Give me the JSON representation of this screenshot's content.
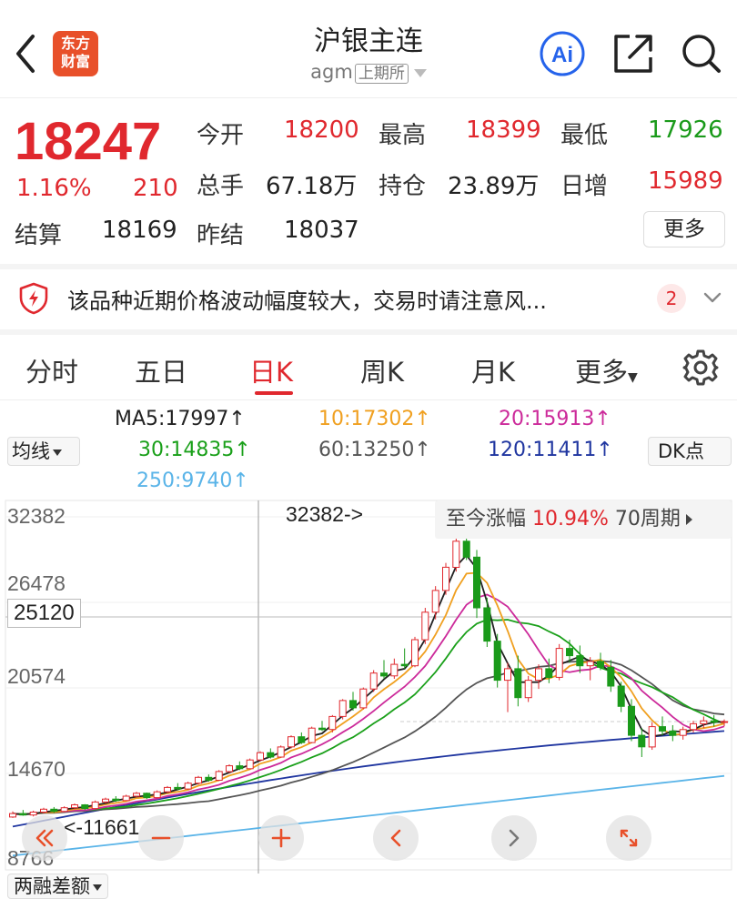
{
  "header": {
    "title": "沪银主连",
    "code": "agm",
    "exchange": "上期所",
    "logo_line1": "东方",
    "logo_line2": "财富",
    "ai_label": "Ai"
  },
  "quote": {
    "price": "18247",
    "change_pct": "1.16%",
    "change": "210",
    "fields": {
      "open_label": "今开",
      "open": "18200",
      "high_label": "最高",
      "high": "18399",
      "low_label": "最低",
      "low": "17926",
      "volume_label": "总手",
      "volume": "67.18万",
      "oi_label": "持仓",
      "oi": "23.89万",
      "daily_inc_label": "日增",
      "daily_inc": "15989",
      "settle_label": "结算",
      "settle": "18169",
      "prev_settle_label": "昨结",
      "prev_settle": "18037"
    },
    "more_label": "更多"
  },
  "notice": {
    "text": "该品种近期价格波动幅度较大，交易时请注意风...",
    "badge": "2"
  },
  "tabs": {
    "items": [
      "分时",
      "五日",
      "日K",
      "周K",
      "月K",
      "更多"
    ],
    "active_index": 2
  },
  "indicators": {
    "ma5": "MA5:17997↑",
    "ma10": "10:17302↑",
    "ma20": "20:15913↑",
    "ma30": "30:14835↑",
    "ma60": "60:13250↑",
    "ma120": "120:11411↑",
    "ma250": "250:9740↑",
    "selector": "均线",
    "dk": "DK点"
  },
  "chart": {
    "y_ticks": [
      "32382",
      "26478",
      "20574",
      "14670",
      "8766"
    ],
    "current_price_tag": "25120",
    "high_marker": "32382->",
    "low_marker": "<-11661",
    "period_label": "至今涨幅",
    "period_pct": "10.94%",
    "period_span": "70周期",
    "bottom_selector": "两融差额"
  },
  "colors": {
    "up": "#e0282e",
    "down": "#1a9a1a",
    "ma5": "#222222",
    "ma10": "#f0a020",
    "ma20": "#cc2a9a",
    "ma30": "#1aa01a",
    "ma60": "#555555",
    "ma120": "#2036a0",
    "ma250": "#5ab4e8"
  },
  "chart_data": {
    "type": "candlestick",
    "title": "",
    "y_range": [
      8766,
      32382
    ],
    "y_ticks": [
      32382,
      26478,
      20574,
      14670,
      8766
    ],
    "high": 32382,
    "low": 11661,
    "ohlc": [
      [
        11661,
        12050,
        11600,
        11900
      ],
      [
        11900,
        12150,
        11750,
        11800
      ],
      [
        11800,
        12100,
        11700,
        12000
      ],
      [
        12000,
        12300,
        11900,
        12200
      ],
      [
        12200,
        12350,
        11950,
        12050
      ],
      [
        12050,
        12400,
        12000,
        12300
      ],
      [
        12300,
        12600,
        12200,
        12500
      ],
      [
        12500,
        12550,
        12150,
        12250
      ],
      [
        12250,
        12800,
        12200,
        12700
      ],
      [
        12700,
        13000,
        12600,
        12900
      ],
      [
        12900,
        13100,
        12700,
        12800
      ],
      [
        12800,
        13200,
        12750,
        13100
      ],
      [
        13100,
        13400,
        13000,
        13300
      ],
      [
        13300,
        13350,
        12900,
        13000
      ],
      [
        13000,
        13500,
        12950,
        13400
      ],
      [
        13400,
        13800,
        13300,
        13700
      ],
      [
        13700,
        14000,
        13500,
        13600
      ],
      [
        13600,
        14100,
        13550,
        14000
      ],
      [
        14000,
        14500,
        13900,
        14400
      ],
      [
        14400,
        14600,
        14100,
        14200
      ],
      [
        14200,
        14900,
        14150,
        14800
      ],
      [
        14800,
        15300,
        14700,
        15200
      ],
      [
        15200,
        15500,
        14900,
        15000
      ],
      [
        15000,
        15700,
        14950,
        15600
      ],
      [
        15600,
        16200,
        15500,
        16100
      ],
      [
        16100,
        16400,
        15700,
        15800
      ],
      [
        15800,
        16600,
        15750,
        16500
      ],
      [
        16500,
        17300,
        16400,
        17200
      ],
      [
        17200,
        17500,
        16700,
        16800
      ],
      [
        16800,
        17900,
        16750,
        17800
      ],
      [
        17800,
        18300,
        17600,
        17700
      ],
      [
        17700,
        18700,
        17500,
        18600
      ],
      [
        18600,
        19800,
        18400,
        19700
      ],
      [
        19700,
        20300,
        19000,
        19200
      ],
      [
        19200,
        20600,
        19100,
        20500
      ],
      [
        20500,
        21800,
        20300,
        21600
      ],
      [
        21600,
        22500,
        21200,
        21400
      ],
      [
        21400,
        22600,
        21200,
        22200
      ],
      [
        22200,
        23300,
        21900,
        22100
      ],
      [
        22100,
        24100,
        22000,
        23900
      ],
      [
        23900,
        26100,
        23600,
        25800
      ],
      [
        25800,
        27600,
        25300,
        27300
      ],
      [
        27300,
        29200,
        27000,
        28900
      ],
      [
        28900,
        31300,
        28600,
        30700
      ],
      [
        30700,
        32382,
        29400,
        29600
      ],
      [
        29600,
        30100,
        25400,
        26100
      ],
      [
        26100,
        26800,
        23400,
        23800
      ],
      [
        23800,
        24300,
        20600,
        21100
      ],
      [
        21100,
        22300,
        18900,
        21900
      ],
      [
        21900,
        22800,
        19300,
        19900
      ],
      [
        19900,
        21400,
        19600,
        21100
      ],
      [
        21100,
        22200,
        20500,
        21900
      ],
      [
        21900,
        22600,
        20900,
        21300
      ],
      [
        21300,
        23600,
        21100,
        23300
      ],
      [
        23300,
        23900,
        22300,
        22800
      ],
      [
        22800,
        23500,
        21600,
        22100
      ],
      [
        22100,
        22700,
        21100,
        22400
      ],
      [
        22400,
        23000,
        21800,
        22000
      ],
      [
        22000,
        22500,
        20300,
        20700
      ],
      [
        20700,
        21000,
        18900,
        19300
      ],
      [
        19300,
        19800,
        16900,
        17300
      ],
      [
        17300,
        17800,
        15800,
        16500
      ],
      [
        16500,
        18200,
        16300,
        17900
      ],
      [
        17900,
        18600,
        17300,
        17600
      ],
      [
        17600,
        18000,
        16900,
        17300
      ],
      [
        17300,
        17900,
        17000,
        17700
      ],
      [
        17700,
        18300,
        17500,
        18100
      ],
      [
        18100,
        18600,
        17800,
        18300
      ],
      [
        18300,
        18700,
        17900,
        18200
      ],
      [
        18200,
        18399,
        17926,
        18247
      ]
    ]
  }
}
